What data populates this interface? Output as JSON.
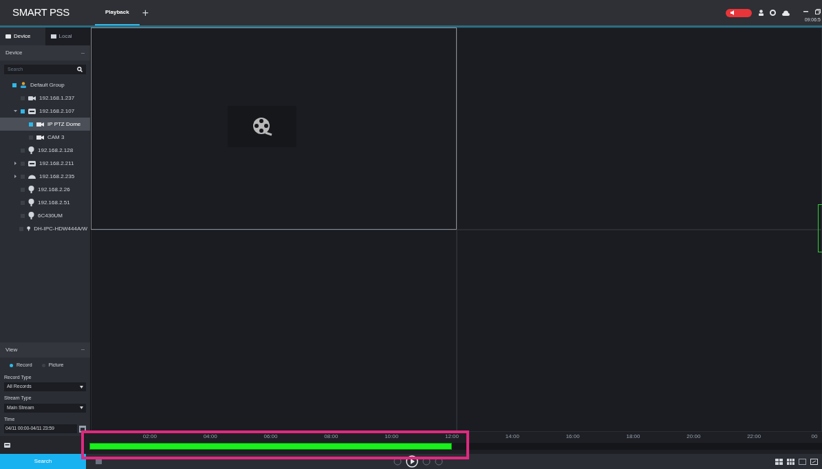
{
  "app": {
    "logo": "SMART PSS",
    "tabs": [
      {
        "label": "Playback",
        "selected": true
      }
    ],
    "add_tab": "+",
    "clock": "09:06:5"
  },
  "sidebar": {
    "tabs": [
      {
        "label": "Device",
        "selected": true
      },
      {
        "label": "Local",
        "selected": false
      }
    ],
    "device_header": "Device",
    "search": {
      "placeholder": "Search"
    },
    "tree": [
      {
        "label": "Default Group",
        "kind": "group",
        "checked": true,
        "selected": false,
        "children": [
          {
            "label": "192.168.1.237",
            "kind": "camera",
            "checked": false,
            "selected": false
          },
          {
            "label": "192.168.2.107",
            "kind": "nvr",
            "checked": true,
            "expanded": true,
            "selected": false,
            "children": [
              {
                "label": "IP PTZ Dome",
                "kind": "channel",
                "checked": true,
                "selected": true
              },
              {
                "label": "CAM 3",
                "kind": "channel",
                "checked": false,
                "selected": false
              }
            ]
          },
          {
            "label": "192.168.2.128",
            "kind": "ipc",
            "checked": false,
            "selected": false
          },
          {
            "label": "192.168.2.211",
            "kind": "nvr",
            "checked": false,
            "expanded": false,
            "selected": false
          },
          {
            "label": "192.168.2.235",
            "kind": "dome",
            "checked": false,
            "expanded": false,
            "selected": false
          },
          {
            "label": "192.168.2.26",
            "kind": "ipc",
            "checked": false,
            "selected": false
          },
          {
            "label": "192.168.2.51",
            "kind": "ipc",
            "checked": false,
            "selected": false
          },
          {
            "label": "6C430UM",
            "kind": "ipc",
            "checked": false,
            "selected": false
          },
          {
            "label": "DH-IPC-HDW444A/W",
            "kind": "ipc",
            "checked": false,
            "selected": false
          }
        ]
      }
    ],
    "view_header": "View",
    "view_options": [
      {
        "label": "Record",
        "selected": true
      },
      {
        "label": "Picture",
        "selected": false
      }
    ],
    "record_type": {
      "label": "Record Type",
      "value": "All Records"
    },
    "stream_type": {
      "label": "Stream Type",
      "value": "Main Stream"
    },
    "time": {
      "label": "Time",
      "value": "04/11 00:00-04/11 23:59"
    },
    "search_button": "Search"
  },
  "video_grid": [
    {
      "selected": true,
      "has_record": true
    },
    {
      "selected": false,
      "has_record": false
    },
    {
      "selected": false,
      "has_record": false
    },
    {
      "selected": false,
      "has_record": false
    }
  ],
  "timeline": {
    "ticks": [
      "02:00",
      "04:00",
      "06:00",
      "08:00",
      "10:00",
      "12:00",
      "14:00",
      "16:00",
      "18:00",
      "20:00",
      "22:00",
      "00"
    ],
    "recording": {
      "level": 0.5
    }
  }
}
